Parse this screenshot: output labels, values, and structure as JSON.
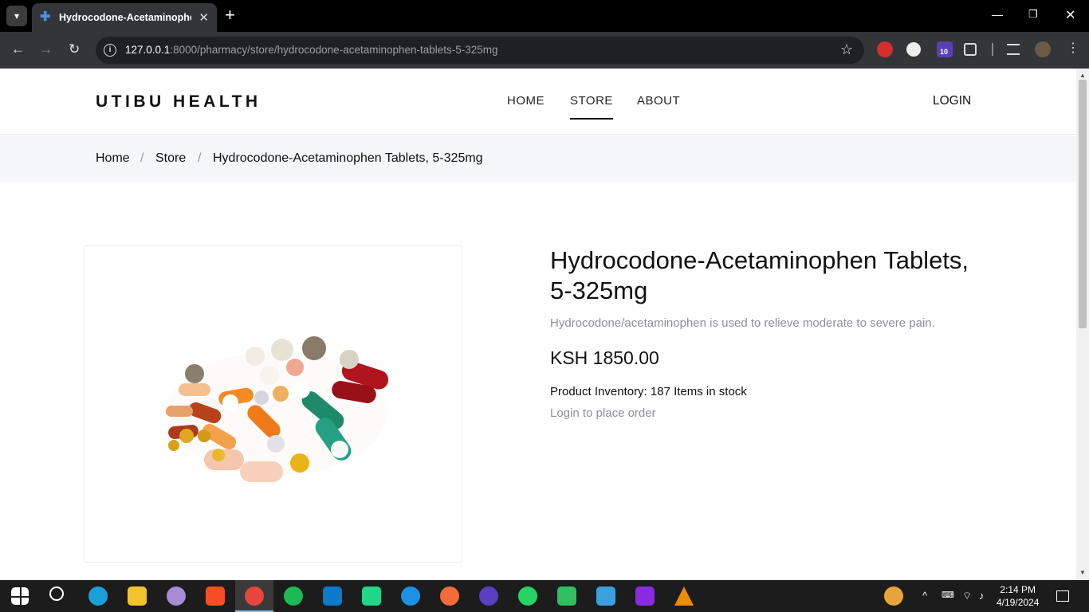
{
  "browser": {
    "tab_title": "Hydrocodone-Acetaminophen",
    "url_host": "127.0.0.1",
    "url_path": ":8000/pharmacy/store/hydrocodone-acetaminophen-tablets-5-325mg",
    "extension_badge": "10"
  },
  "site": {
    "logo": "UTIBU HEALTH",
    "nav": [
      {
        "label": "HOME"
      },
      {
        "label": "STORE"
      },
      {
        "label": "ABOUT"
      }
    ],
    "login": "LOGIN"
  },
  "breadcrumb": {
    "items": [
      "Home",
      "Store",
      "Hydrocodone-Acetaminophen Tablets, 5-325mg"
    ],
    "separator": "/"
  },
  "product": {
    "title": "Hydrocodone-Acetaminophen Tablets, 5-325mg",
    "description": "Hydrocodone/acetaminophen is used to relieve moderate to severe pain.",
    "price": "KSH 1850.00",
    "inventory": "Product Inventory: 187 Items in stock",
    "cta": "Login to place order"
  },
  "taskbar": {
    "time": "2:14 PM",
    "date": "4/19/2024"
  }
}
